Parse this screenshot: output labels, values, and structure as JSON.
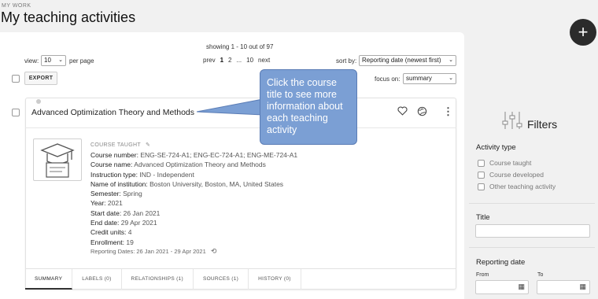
{
  "header": {
    "eyebrow": "MY WORK",
    "title": "My teaching activities",
    "add_icon": "plus-icon"
  },
  "toolbar": {
    "showing": "showing 1 - 10 out of 97",
    "view_label": "view:",
    "view_value": "10",
    "per_page": "per page",
    "pager": {
      "prev": "prev",
      "pages": [
        "1",
        "2",
        "...",
        "10"
      ],
      "next": "next"
    },
    "sort_label": "sort by:",
    "sort_value": "Reporting date (newest first)",
    "focus_label": "focus on:",
    "focus_value": "summary",
    "export_label": "EXPORT"
  },
  "card": {
    "title": "Advanced Optimization Theory and Methods",
    "icons": [
      "heart-icon",
      "globe-icon",
      "more-vertical-icon"
    ],
    "type_label": "COURSE TAUGHT",
    "fields": [
      {
        "k": "Course number:",
        "v": "ENG-SE-724-A1; ENG-EC-724-A1; ENG-ME-724-A1"
      },
      {
        "k": "Course name:",
        "v": "Advanced Optimization Theory and Methods"
      },
      {
        "k": "Instruction type:",
        "v": "IND - Independent"
      },
      {
        "k": "Name of institution:",
        "v": "Boston University, Boston, MA, United States"
      },
      {
        "k": "Semester:",
        "v": "Spring"
      },
      {
        "k": "Year:",
        "v": "2021"
      },
      {
        "k": "Start date:",
        "v": "26 Jan 2021"
      },
      {
        "k": "End date:",
        "v": "29 Apr 2021"
      },
      {
        "k": "Credit units:",
        "v": "4"
      },
      {
        "k": "Enrollment:",
        "v": "19"
      }
    ],
    "reporting_dates": "Reporting Dates: 26 Jan 2021 - 29 Apr 2021",
    "tabs": [
      "SUMMARY",
      "LABELS (0)",
      "RELATIONSHIPS (1)",
      "SOURCES (1)",
      "HISTORY (0)"
    ]
  },
  "callout": "Click the course title to see more information about each teaching activity",
  "filters": {
    "title": "Filters",
    "activity_type_label": "Activity type",
    "activity_types": [
      "Course taught",
      "Course developed",
      "Other teaching activity"
    ],
    "title_label": "Title",
    "reporting_date_label": "Reporting date",
    "from_label": "From",
    "to_label": "To"
  },
  "colors": {
    "callout": "#7b9fd4",
    "fab": "#2b2b2b",
    "background": "#f1f1f1"
  }
}
